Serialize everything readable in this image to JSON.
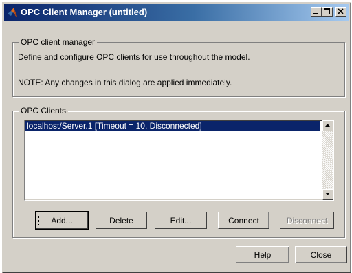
{
  "window": {
    "title": "OPC Client Manager (untitled)",
    "title_buttons": [
      "minimize",
      "maximize",
      "close"
    ]
  },
  "manager_group": {
    "legend": "OPC client manager",
    "description": "Define and configure OPC clients for use throughout the model.",
    "note": "NOTE: Any changes in this dialog are applied immediately."
  },
  "clients_group": {
    "legend": "OPC Clients",
    "items": [
      {
        "label": "localhost/Server.1 [Timeout = 10, Disconnected]",
        "selected": true
      }
    ],
    "buttons": {
      "add": "Add...",
      "delete": "Delete",
      "edit": "Edit...",
      "connect": "Connect",
      "disconnect": "Disconnect"
    }
  },
  "footer": {
    "help": "Help",
    "close": "Close"
  },
  "colors": {
    "title_gradient_start": "#0a246a",
    "title_gradient_end": "#a6caf0",
    "face": "#d4d0c8",
    "selection": "#0a246a"
  },
  "icons": {
    "app": "matlab-logo-icon",
    "minimize": "minimize-icon",
    "maximize": "maximize-icon",
    "close": "close-icon",
    "scroll_up": "arrow-up-icon",
    "scroll_down": "arrow-down-icon"
  }
}
